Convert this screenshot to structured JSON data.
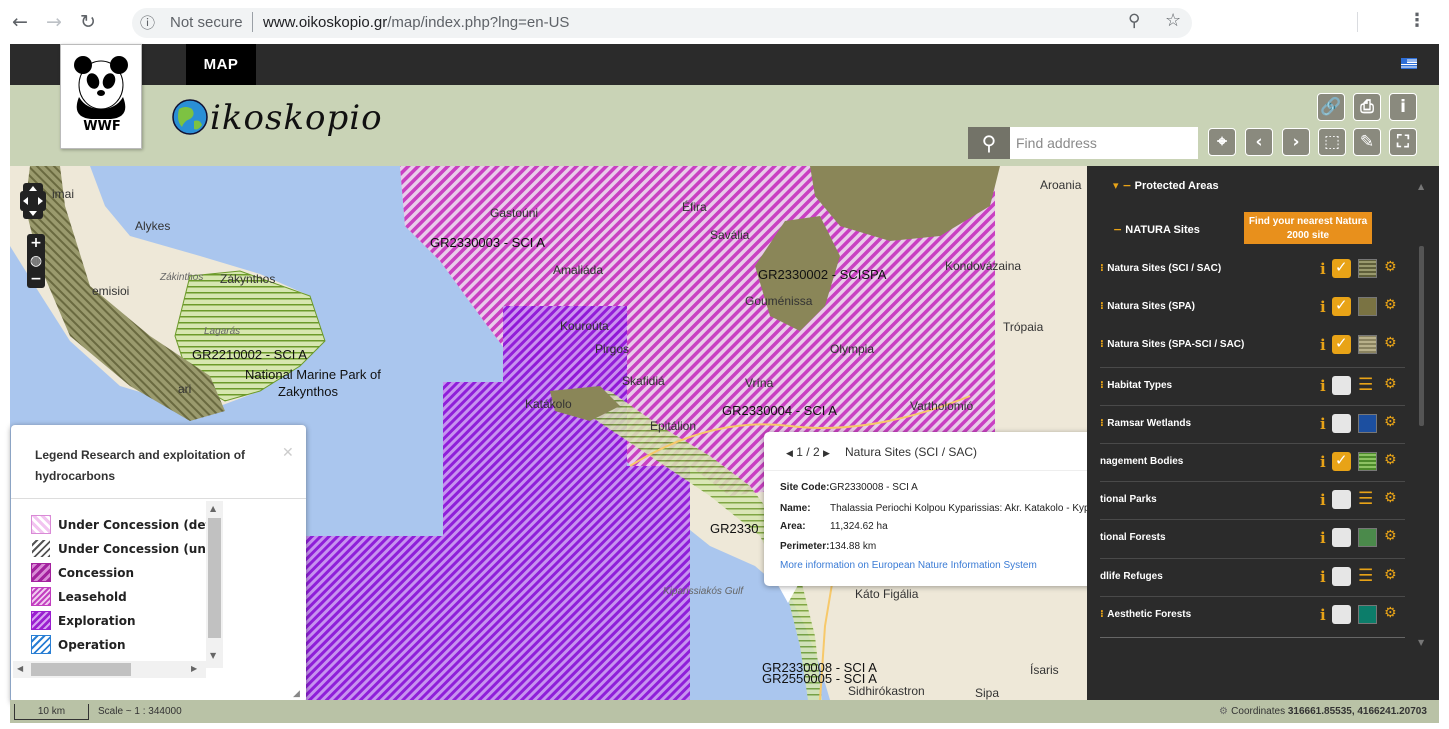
{
  "browser": {
    "secure_label": "Not secure",
    "url_host": "www.oikoskopio.gr",
    "url_path": "/map/index.php?lng=en-US",
    "icons": [
      "back-arrow-icon",
      "forward-arrow-icon",
      "reload-icon",
      "info-icon",
      "zoom-icon",
      "star-icon",
      "menu-icon"
    ]
  },
  "app": {
    "tab_label": "MAP",
    "logo_text": "WWF",
    "brand_text": "ikoskopio",
    "search_placeholder": "Find address",
    "header_buttons": [
      "link-icon",
      "print-icon",
      "info-icon",
      "locate-icon",
      "back-icon",
      "forward-icon",
      "select-icon",
      "measure-icon",
      "fullscreen-icon"
    ],
    "colors": {
      "topbar": "#2b2b2b",
      "header": "#c9d3b6",
      "accent": "#e8a317",
      "button": "#e8901c"
    }
  },
  "map": {
    "labels": {
      "alykes": "Alykes",
      "zakinthos_ital": "Zákinthos",
      "zakynthos": "Zákynthos",
      "temisioi": "emisioi",
      "imai": "imai",
      "lagaras": "Lagarás",
      "code_2210002": "GR2210002 - SCI A",
      "nmp1": "National Marine Park of",
      "nmp2": "Zakynthos",
      "ari": "ari",
      "code_2330003": "GR2330003 - SCI A",
      "code_2330002": "GR2330002 - SCISPA",
      "code_2330004": "GR2330004 - SCI A",
      "code_2330": "GR2330",
      "code_2330008": "GR2330008 - SCI A",
      "code_2550005": "GR2550005 - SCI A",
      "aroania": "Aroania",
      "tropaia": "Trópaia",
      "kato_figalia": "Káto Figália",
      "sidhirokastron": "Sidhirókastron",
      "isaris": "Ísaris",
      "kiparissiakos": "Kiparissiakós Gulf",
      "efira": "Éfira",
      "kondovazaina": "Kondovázaina",
      "gastouni": "Gastoúni",
      "amaliada": "Amaliáda",
      "savalia": "Savália",
      "vartholomio": "Vartholomió",
      "gouménissa": "Gouménissa",
      "kourouta": "Kouroúta",
      "pirgos": "Pirgos",
      "katakolo": "Katákolo",
      "skafidia": "Skafidiá",
      "epitalio": "Epitálion",
      "olympia": "Olympia",
      "vrina": "Vrína",
      "sipa": "Sipa"
    }
  },
  "legend": {
    "title": "Legend Research and exploitation of hydrocarbons",
    "items": [
      {
        "label": "Under Concession (defined)",
        "color": "#e9a0e6",
        "style": "pink-lines"
      },
      {
        "label": "Under Concession (undefined)",
        "color": "#555555",
        "style": "gray-lines"
      },
      {
        "label": "Concession",
        "color": "#a3229e",
        "style": "purple-lines"
      },
      {
        "label": "Leasehold",
        "color": "#c23ec0",
        "style": "hatched"
      },
      {
        "label": "Exploration",
        "color": "#9b1fd0",
        "style": "violet-lines"
      },
      {
        "label": "Operation",
        "color": "#2a7fd4",
        "style": "blue-lines"
      }
    ]
  },
  "popup": {
    "nav": "1 / 2",
    "layer": "Natura Sites (SCI / SAC)",
    "site_code_label": "Site Code:",
    "site_code": "GR2330008 - SCI A",
    "name_label": "Name:",
    "name": "Thalassia Periochi Kolpou Kyparissias: Akr. Katakolo - Kyparissia",
    "area_label": "Area:",
    "area": "11,324.62 ha",
    "perimeter_label": "Perimeter:",
    "perimeter": "134.88 km",
    "link": "More information on European Nature Information System"
  },
  "sidebar": {
    "group_protected": "Protected Areas",
    "group_natura": "NATURA Sites",
    "natura_button": "Find your nearest Natura 2000 site",
    "layers": [
      {
        "label": "Natura Sites (SCI / SAC)",
        "checked": true,
        "swatch": "#5f5f3a",
        "swatch_style": "lines"
      },
      {
        "label": "Natura Sites (SPA)",
        "checked": true,
        "swatch": "#7a7343",
        "swatch_style": "solid"
      },
      {
        "label": "Natura Sites (SPA-SCI / SAC)",
        "checked": true,
        "swatch": "#8a8360",
        "swatch_style": "lines"
      },
      {
        "label": "Habitat Types",
        "checked": false,
        "swatch": "",
        "swatch_style": "list"
      },
      {
        "label": "Ramsar Wetlands",
        "checked": false,
        "swatch": "#1c4fa0",
        "swatch_style": "solid"
      },
      {
        "label": "nagement Bodies",
        "checked": true,
        "swatch": "#4c8a2a",
        "swatch_style": "lines"
      },
      {
        "label": "tional Parks",
        "checked": false,
        "swatch": "",
        "swatch_style": "list"
      },
      {
        "label": "tional Forests",
        "checked": false,
        "swatch": "#4b8a4b",
        "swatch_style": "solid"
      },
      {
        "label": "dlife Refuges",
        "checked": false,
        "swatch": "",
        "swatch_style": "list"
      },
      {
        "label": "Aesthetic Forests",
        "checked": false,
        "swatch": "#0c7d6a",
        "swatch_style": "solid"
      }
    ]
  },
  "footer": {
    "scale_bar": "10 km",
    "scale_text": "Scale ~ 1 : 344000",
    "coords_label": "Coordinates",
    "coords_value": "316661.85535, 4166241.20703"
  }
}
